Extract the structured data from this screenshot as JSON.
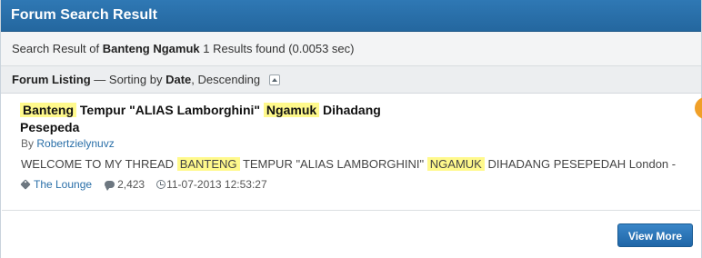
{
  "header": {
    "title": "Forum Search Result"
  },
  "summary": {
    "prefix": "Search Result of",
    "query": "Banteng Ngamuk",
    "count_text": "1 Results found (0.0053 sec)"
  },
  "listing": {
    "title": "Forum Listing",
    "sort_prefix": "— Sorting by",
    "sort_key": "Date",
    "sort_order": ", Descending"
  },
  "result": {
    "title_parts": [
      "Banteng",
      "Tempur \"ALIAS Lamborghini\"",
      "Ngamuk",
      "Dihadang",
      "Pesepeda"
    ],
    "author_prefix": "By",
    "author": "Robertzielynuvz",
    "snippet_parts": [
      "WELCOME TO MY THREAD",
      "BANTENG",
      "TEMPUR \"ALIAS LAMBORGHINI\"",
      "NGAMUK",
      "DIHADANG PESEPEDAH London -"
    ],
    "forum": "The Lounge",
    "replies": "2,423",
    "timestamp": "11-07-2013 12:53:27"
  },
  "buttons": {
    "view_more": "View More"
  },
  "colors": {
    "header_bg": "#2a70ad",
    "highlight": "#fff98c",
    "link": "#2a6fa8",
    "button_bg": "#2b77ba"
  },
  "icons": [
    "tag-icon",
    "comment-icon",
    "clock-icon",
    "collapse-icon"
  ]
}
